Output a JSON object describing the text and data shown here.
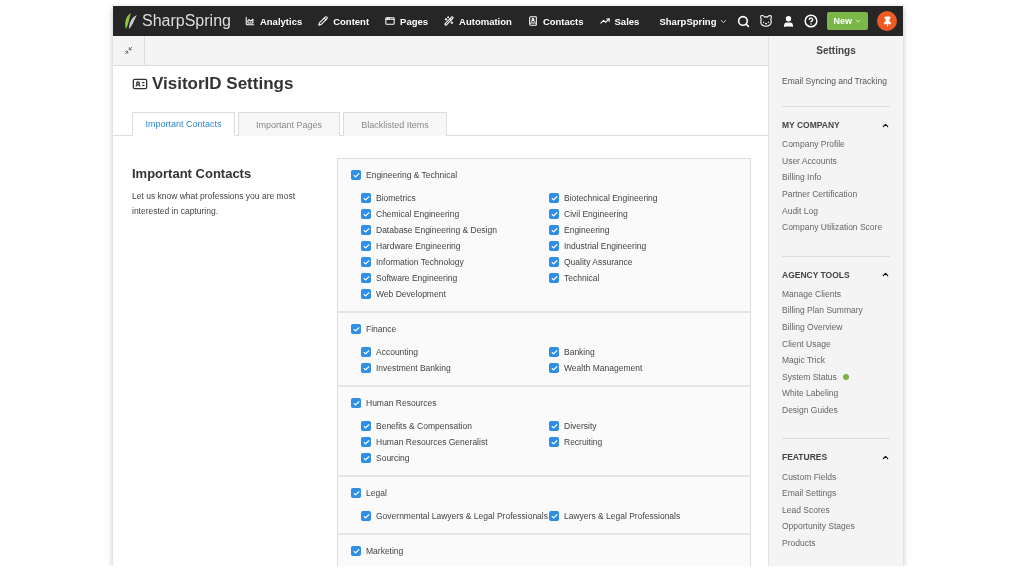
{
  "nav": {
    "logo": "SharpSpring",
    "items": [
      {
        "kind": "analytics",
        "label": "Analytics"
      },
      {
        "kind": "content",
        "label": "Content"
      },
      {
        "kind": "pages",
        "label": "Pages"
      },
      {
        "kind": "automation",
        "label": "Automation"
      },
      {
        "kind": "contacts",
        "label": "Contacts"
      },
      {
        "kind": "sales",
        "label": "Sales"
      }
    ],
    "account": "SharpSpring",
    "new_button": "New"
  },
  "page": {
    "title": "VisitorID Settings",
    "tabs": [
      {
        "label": "Important Contacts",
        "selected": true
      },
      {
        "label": "Important Pages",
        "selected": false
      },
      {
        "label": "Blacklisted Items",
        "selected": false
      }
    ],
    "section": {
      "heading": "Important Contacts",
      "description": "Let us know what professions you are most interested in capturing."
    },
    "groups": [
      {
        "label": "Engineering & Technical",
        "checked": true,
        "children": [
          {
            "label": "Biometrics",
            "checked": true
          },
          {
            "label": "Biotechnical Engineering",
            "checked": true
          },
          {
            "label": "Chemical Engineering",
            "checked": true
          },
          {
            "label": "Civil Engineering",
            "checked": true
          },
          {
            "label": "Database Engineering & Design",
            "checked": true
          },
          {
            "label": "Engineering",
            "checked": true
          },
          {
            "label": "Hardware Engineering",
            "checked": true
          },
          {
            "label": "Industrial Engineering",
            "checked": true
          },
          {
            "label": "Information Technology",
            "checked": true
          },
          {
            "label": "Quality Assurance",
            "checked": true
          },
          {
            "label": "Software Engineering",
            "checked": true
          },
          {
            "label": "Technical",
            "checked": true
          },
          {
            "label": "Web Development",
            "checked": true
          }
        ]
      },
      {
        "label": "Finance",
        "checked": true,
        "children": [
          {
            "label": "Accounting",
            "checked": true
          },
          {
            "label": "Banking",
            "checked": true
          },
          {
            "label": "Investment Banking",
            "checked": true
          },
          {
            "label": "Wealth Management",
            "checked": true
          }
        ]
      },
      {
        "label": "Human Resources",
        "checked": true,
        "children": [
          {
            "label": "Benefits & Compensation",
            "checked": true
          },
          {
            "label": "Diversity",
            "checked": true
          },
          {
            "label": "Human Resources Generalist",
            "checked": true
          },
          {
            "label": "Recruiting",
            "checked": true
          },
          {
            "label": "Sourcing",
            "checked": true
          }
        ]
      },
      {
        "label": "Legal",
        "checked": true,
        "children": [
          {
            "label": "Governmental Lawyers & Legal Professionals",
            "checked": true
          },
          {
            "label": "Lawyers & Legal Professionals",
            "checked": true
          }
        ]
      },
      {
        "label": "Marketing",
        "checked": true
      }
    ]
  },
  "sidebar": {
    "title": "Settings",
    "top_link": "Email Syncing and Tracking",
    "sections": [
      {
        "title": "MY COMPANY",
        "expanded": true,
        "items": [
          {
            "label": "Company Profile"
          },
          {
            "label": "User Accounts"
          },
          {
            "label": "Billing Info"
          },
          {
            "label": "Partner Certification"
          },
          {
            "label": "Audit Log"
          },
          {
            "label": "Company Utilization Score"
          }
        ]
      },
      {
        "title": "AGENCY TOOLS",
        "expanded": true,
        "items": [
          {
            "label": "Manage Clients"
          },
          {
            "label": "Billing Plan Summary"
          },
          {
            "label": "Billing Overview"
          },
          {
            "label": "Client Usage"
          },
          {
            "label": "Magic Trick"
          },
          {
            "label": "System Status",
            "color": "#7cb342"
          },
          {
            "label": "White Labeling"
          },
          {
            "label": "Design Guides"
          }
        ]
      },
      {
        "title": "FEATURES",
        "expanded": true,
        "items": [
          {
            "label": "Custom Fields"
          },
          {
            "label": "Email Settings"
          },
          {
            "label": "Lead Scores"
          },
          {
            "label": "Opportunity Stages"
          },
          {
            "label": "Products"
          }
        ]
      }
    ]
  }
}
